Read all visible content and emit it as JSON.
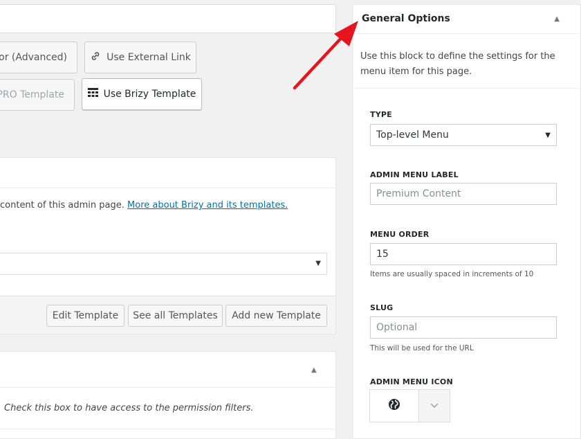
{
  "left": {
    "editor_buttons": {
      "advanced_editor": "itor (Advanced)",
      "external_link": "Use External Link",
      "pro_template": "PRO Template",
      "brizy_template": "Use Brizy Template"
    },
    "template_panel": {
      "description": "content of this admin page.",
      "link_text": "More about Brizy and its templates."
    },
    "footer_buttons": {
      "edit_template": "Edit Template",
      "see_all": "See all Templates",
      "add_new": "Add new Template"
    },
    "permissions": {
      "text": "Check this box to have access to the permission filters."
    }
  },
  "sidebar": {
    "title": "General Options",
    "description": "Use this block to define the settings for the menu item for this page.",
    "type": {
      "label": "TYPE",
      "value": "Top-level Menu"
    },
    "admin_menu_label": {
      "label": "ADMIN MENU LABEL",
      "placeholder": "Premium Content"
    },
    "menu_order": {
      "label": "MENU ORDER",
      "value": "15",
      "help": "Items are usually spaced in increments of 10"
    },
    "slug": {
      "label": "SLUG",
      "placeholder": "Optional",
      "help": "This will be used for the URL"
    },
    "admin_menu_icon": {
      "label": "ADMIN MENU ICON",
      "icon": "globe-icon"
    }
  },
  "annotation": {
    "color": "#e8141c"
  }
}
